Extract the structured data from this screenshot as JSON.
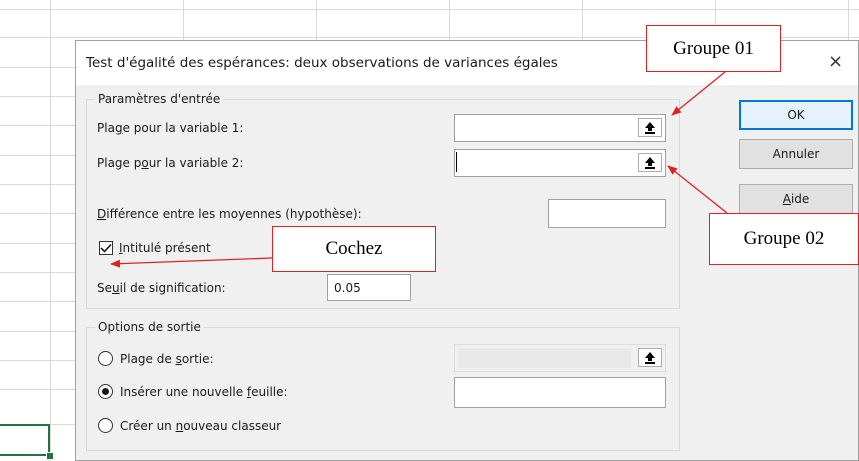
{
  "dialog": {
    "title": "Test d'égalité des espérances: deux observations de variances égales",
    "help_glyph": "?",
    "close_glyph": "×"
  },
  "input_group": {
    "legend": "Paramètres d'entrée",
    "var1": {
      "pre": "Pla",
      "acc": "g",
      "post": "e pour la variable 1:",
      "value": ""
    },
    "var2": {
      "pre": "Plage p",
      "acc": "o",
      "post": "ur la variable 2:",
      "value": ""
    },
    "diff": {
      "pre": "",
      "acc": "D",
      "post": "ifférence entre les moyennes (hypothèse):",
      "value": ""
    },
    "labels_checkbox": {
      "pre": "",
      "acc": "I",
      "post": "ntitulé présent",
      "checked": true
    },
    "alpha": {
      "pre": "Se",
      "acc": "u",
      "post": "il de signification:",
      "value": "0.05"
    }
  },
  "output_group": {
    "legend": "Options de sortie",
    "range": {
      "pre": "Plage de ",
      "acc": "s",
      "post": "ortie:",
      "selected": false
    },
    "new_sheet": {
      "pre": "Insérer une nouvelle ",
      "acc": "f",
      "post": "euille:",
      "selected": true
    },
    "new_workbook": {
      "pre": "Créer un ",
      "acc": "n",
      "post": "ouveau classeur",
      "selected": false
    }
  },
  "buttons": {
    "ok": "OK",
    "cancel": "Annuler",
    "help": {
      "pre": "",
      "acc": "A",
      "post": "ide"
    }
  },
  "annotations": {
    "groupe01": "Groupe 01",
    "groupe02": "Groupe 02",
    "cochez": "Cochez"
  },
  "colors": {
    "annotation_red": "#dd2222",
    "default_button_border": "#0078d7",
    "excel_green": "#217346"
  },
  "icons": {
    "collapse": "upload-arrow-icon",
    "checkmark": "checkmark-icon"
  }
}
